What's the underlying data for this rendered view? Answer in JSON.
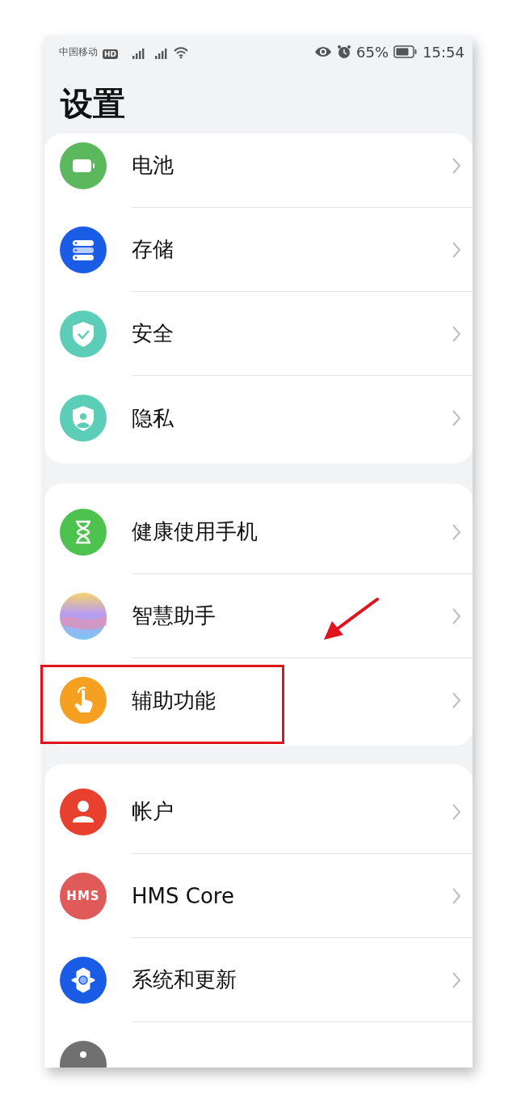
{
  "status_bar": {
    "carrier": "中国移动",
    "carrier_badge": "HD",
    "battery_percent": "65%",
    "time": "15:54"
  },
  "title": "设置",
  "groups": [
    {
      "items": [
        {
          "label": "电池",
          "kind": "battery",
          "color": "#5cb85c",
          "annotated": false
        },
        {
          "label": "存储",
          "kind": "storage",
          "color": "#1a5ce6",
          "annotated": false
        },
        {
          "label": "安全",
          "kind": "shield-check",
          "color": "#5ccdb6",
          "annotated": false
        },
        {
          "label": "隐私",
          "kind": "shield-person",
          "color": "#5ccdb6",
          "annotated": false
        }
      ]
    },
    {
      "items": [
        {
          "label": "健康使用手机",
          "kind": "hourglass",
          "color": "#4ec24e",
          "annotated": false
        },
        {
          "label": "智慧助手",
          "kind": "orb",
          "color": "#b89cf0",
          "annotated": false
        },
        {
          "label": "辅助功能",
          "kind": "hand",
          "color": "#f5a020",
          "annotated": true
        }
      ]
    },
    {
      "items": [
        {
          "label": "帐户",
          "kind": "person",
          "color": "#e8402e",
          "annotated": false
        },
        {
          "label": "HMS Core",
          "kind": "text",
          "icon_text": "HMS",
          "color": "#e05a5a",
          "annotated": false
        },
        {
          "label": "系统和更新",
          "kind": "gear",
          "color": "#1a5ce6",
          "annotated": false
        },
        {
          "kind": "partial",
          "color": "#707070",
          "annotated": false
        }
      ]
    }
  ]
}
